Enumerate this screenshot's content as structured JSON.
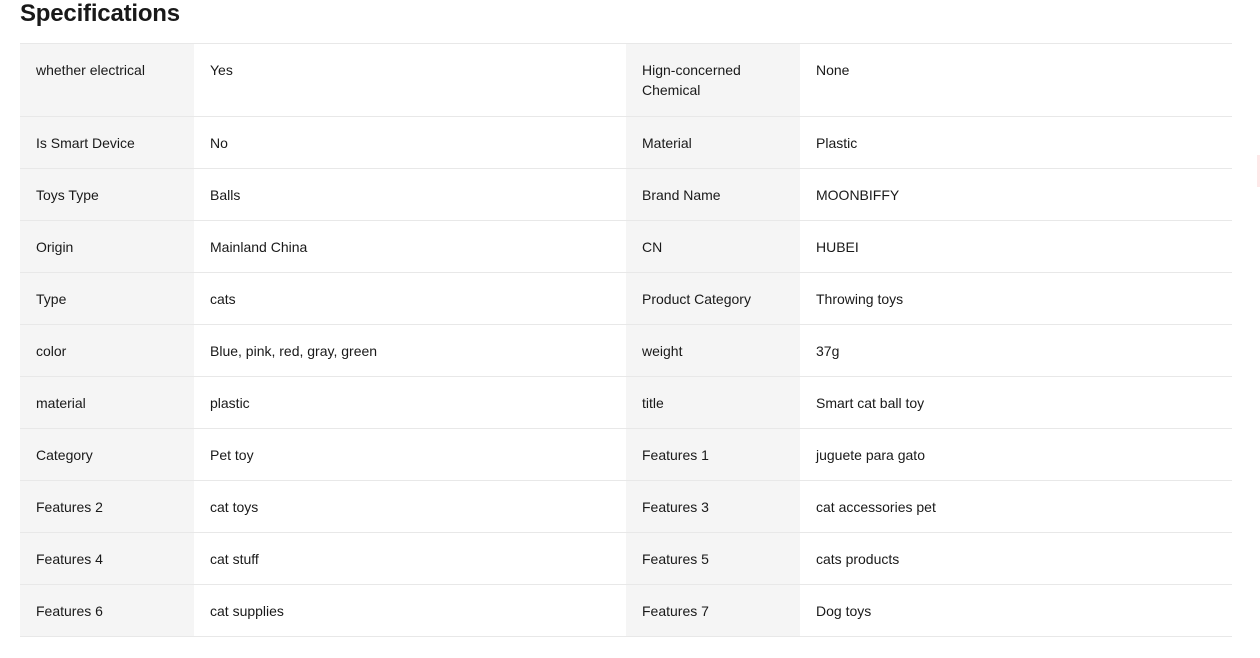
{
  "title": "Specifications",
  "rows": [
    {
      "k1": "whether electrical",
      "v1": "Yes",
      "k2": "Hign-concerned Chemical",
      "v2": "None"
    },
    {
      "k1": "Is Smart Device",
      "v1": "No",
      "k2": "Material",
      "v2": "Plastic"
    },
    {
      "k1": "Toys Type",
      "v1": "Balls",
      "k2": "Brand Name",
      "v2": "MOONBIFFY"
    },
    {
      "k1": "Origin",
      "v1": "Mainland China",
      "k2": "CN",
      "v2": "HUBEI"
    },
    {
      "k1": "Type",
      "v1": "cats",
      "k2": "Product Category",
      "v2": "Throwing toys"
    },
    {
      "k1": "color",
      "v1": "Blue, pink, red, gray, green",
      "k2": "weight",
      "v2": "37g"
    },
    {
      "k1": "material",
      "v1": "plastic",
      "k2": "title",
      "v2": "Smart cat ball toy"
    },
    {
      "k1": "Category",
      "v1": "Pet toy",
      "k2": "Features 1",
      "v2": "juguete para gato"
    },
    {
      "k1": "Features 2",
      "v1": "cat toys",
      "k2": "Features 3",
      "v2": "cat accessories pet"
    },
    {
      "k1": "Features 4",
      "v1": "cat stuff",
      "k2": "Features 5",
      "v2": "cats products"
    },
    {
      "k1": "Features 6",
      "v1": "cat supplies",
      "k2": "Features 7",
      "v2": "Dog toys"
    }
  ]
}
